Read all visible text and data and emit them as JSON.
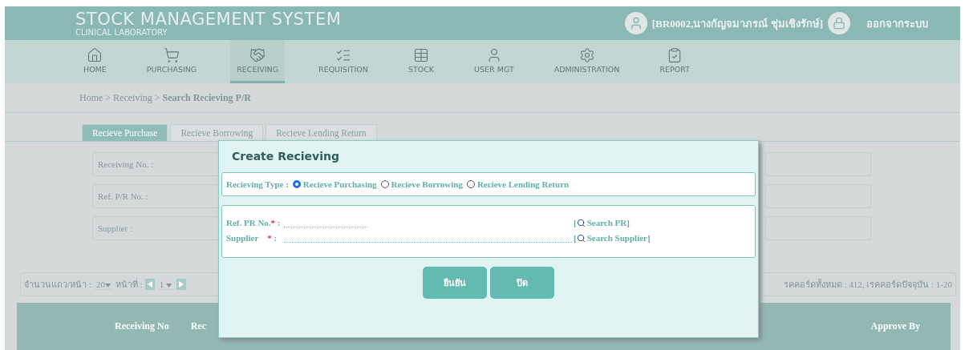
{
  "header": {
    "title": "STOCK MANAGEMENT SYSTEM",
    "subtitle": "CLINICAL LABORATORY",
    "user": "[BR0002,นางกัญจมาภรณ์ ชุ่มเชิงรักษ์]",
    "logout": "ออกจากระบบ"
  },
  "nav": [
    {
      "label": "HOME",
      "selected": false
    },
    {
      "label": "PURCHASING",
      "selected": false
    },
    {
      "label": "RECEIVING",
      "selected": true
    },
    {
      "label": "REQUISITION",
      "selected": false
    },
    {
      "label": "STOCK",
      "selected": false
    },
    {
      "label": "USER MGT",
      "selected": false
    },
    {
      "label": "ADMINISTRATION",
      "selected": false
    },
    {
      "label": "REPORT",
      "selected": false
    }
  ],
  "breadcrumb": "Home > Receiving > **Search Recieving P/R**",
  "tabs": [
    {
      "label": "Recieve Purchase",
      "selected": true
    },
    {
      "label": "Recieve Borrowing",
      "selected": false
    },
    {
      "label": "Recieve Lending Return",
      "selected": false
    }
  ],
  "search_fields": [
    "Receiving No. :",
    "Ref. P/R No. :",
    "Supplier :"
  ],
  "pager": {
    "rows_label": "จำนวนแถว/หน้า :",
    "rows_value": "20",
    "page_label": "หน้าที่ :",
    "page_value": "1",
    "records": "รคคอร์ดทั้งหมด : 412, เรคคอร์ดปัจจุบัน : 1-20"
  },
  "table": {
    "columns": [
      "Receiving No",
      "Rec",
      "Approve By"
    ]
  },
  "dialog": {
    "title": "Create Recieving",
    "type_label": "Recieving Type :",
    "type_options": [
      {
        "label": "Recieve Purchasing",
        "selected": true
      },
      {
        "label": "Recieve Borrowing",
        "selected": false
      },
      {
        "label": "Recieve Lending Return",
        "selected": false
      }
    ],
    "fields": [
      {
        "label": "Ref. PR No.",
        "marker": "*",
        "separator": ":",
        "link": "Search PR]",
        "bracket": "["
      },
      {
        "label": "Supplier",
        "marker": "*",
        "separator": ":",
        "link": "Search Supplier]",
        "bracket": "["
      }
    ],
    "buttons": [
      "ยืนยัน",
      "ปิด"
    ]
  }
}
